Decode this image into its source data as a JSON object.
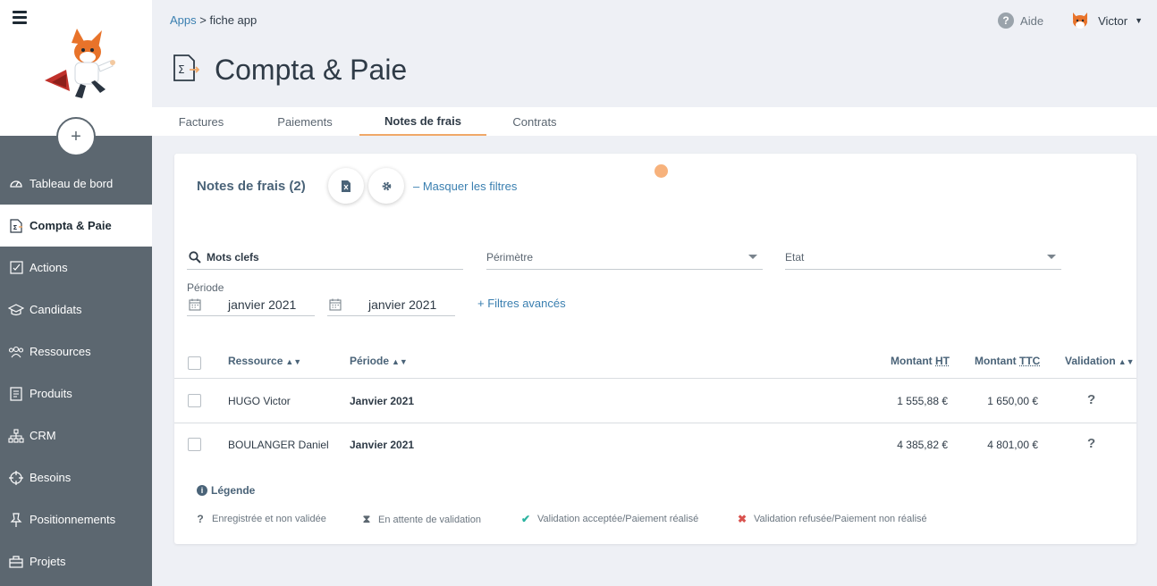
{
  "sidebar": {
    "items": [
      {
        "label": "Tableau de bord",
        "icon": "dashboard-icon"
      },
      {
        "label": "Compta & Paie",
        "icon": "invoice-icon",
        "active": true
      },
      {
        "label": "Actions",
        "icon": "checklist-icon"
      },
      {
        "label": "Candidats",
        "icon": "graduation-cap-icon"
      },
      {
        "label": "Ressources",
        "icon": "users-icon"
      },
      {
        "label": "Produits",
        "icon": "document-icon"
      },
      {
        "label": "CRM",
        "icon": "org-chart-icon"
      },
      {
        "label": "Besoins",
        "icon": "crosshair-icon"
      },
      {
        "label": "Positionnements",
        "icon": "pin-icon"
      },
      {
        "label": "Projets",
        "icon": "briefcase-icon"
      }
    ]
  },
  "header": {
    "breadcrumb_apps": "Apps",
    "breadcrumb_sep": ">",
    "breadcrumb_current": "fiche app",
    "help_label": "Aide",
    "user_name": "Victor",
    "page_title": "Compta & Paie"
  },
  "tabs": [
    {
      "label": "Factures"
    },
    {
      "label": "Paiements"
    },
    {
      "label": "Notes de frais",
      "active": true
    },
    {
      "label": "Contrats"
    }
  ],
  "card": {
    "title": "Notes de frais (2)",
    "hide_filters": "– Masquer les filtres",
    "search_placeholder": "Mots clefs",
    "perimetre_label": "Périmètre",
    "etat_label": "Etat",
    "periode_label": "Période",
    "date_from": "janvier 2021",
    "date_to": "janvier 2021",
    "advanced_filters": "+ Filtres avancés"
  },
  "table": {
    "headers": {
      "ressource": "Ressource",
      "periode": "Période",
      "montant": "Montant",
      "ht": "HT",
      "ttc": "TTC",
      "validation": "Validation"
    },
    "rows": [
      {
        "ressource": "HUGO Victor",
        "periode": "Janvier 2021",
        "ht": "1 555,88 €",
        "ttc": "1 650,00 €",
        "status": "?"
      },
      {
        "ressource": "BOULANGER Daniel",
        "periode": "Janvier 2021",
        "ht": "4 385,82 €",
        "ttc": "4 801,00 €",
        "status": "?"
      }
    ]
  },
  "legend": {
    "title": "Légende",
    "items": [
      {
        "symbol": "?",
        "label": "Enregistrée et non validée",
        "color": "#5c6770"
      },
      {
        "symbol": "⧗",
        "label": "En attente de validation",
        "color": "#5c6770"
      },
      {
        "symbol": "✔",
        "label": "Validation acceptée/Paiement réalisé",
        "color": "#2bb3a0"
      },
      {
        "symbol": "✖",
        "label": "Validation refusée/Paiement non réalisé",
        "color": "#d9534f"
      }
    ]
  },
  "colors": {
    "sidebar": "#5c6770",
    "accent": "#f0a868",
    "link": "#3a7fb0"
  }
}
